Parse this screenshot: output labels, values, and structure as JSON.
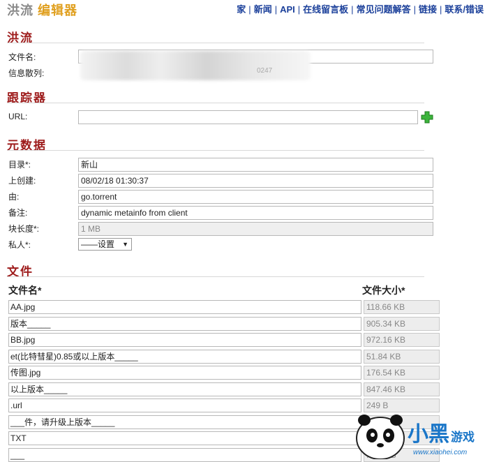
{
  "header": {
    "title_part1": "洪流",
    "title_part2": "编辑器",
    "nav": [
      "家",
      "新闻",
      "API",
      "在线留言板",
      "常见问题解答",
      "链接",
      "联系/错误"
    ]
  },
  "torrent": {
    "section_title": "洪流",
    "filename_label": "文件名:",
    "filename_value": "",
    "infohash_label": "信息散列:",
    "infohash_value": "0247"
  },
  "tracker": {
    "section_title": "跟踪器",
    "url_label": "URL:",
    "url_value": ""
  },
  "metadata": {
    "section_title": "元数据",
    "fields": [
      {
        "label": "目录*:",
        "value": "新山"
      },
      {
        "label": "上创建:",
        "value": "08/02/18 01:30:37"
      },
      {
        "label": "由:",
        "value": "go.torrent"
      },
      {
        "label": "备注:",
        "value": "dynamic metainfo from client"
      },
      {
        "label": "块长度*:",
        "value": "1 MB"
      }
    ],
    "private_label": "私人*:",
    "private_value": "——设置"
  },
  "files": {
    "section_title": "文件",
    "col_name": "文件名*",
    "col_size": "文件大小*",
    "rows": [
      {
        "name": "AA.jpg",
        "size": "118.66 KB"
      },
      {
        "name": "版本_____",
        "size": "905.34 KB"
      },
      {
        "name": "BB.jpg",
        "size": "972.16 KB"
      },
      {
        "name": "et(比特彗星)0.85或以上版本_____",
        "size": "51.84 KB"
      },
      {
        "name": "传图.jpg",
        "size": "176.54 KB"
      },
      {
        "name": "以上版本_____",
        "size": "847.46 KB"
      },
      {
        "name": ".url",
        "size": "249 B"
      },
      {
        "name": "___件，请升级上版本_____",
        "size": "...6 KB"
      },
      {
        "name": "TXT",
        "size": ""
      },
      {
        "name": "___",
        "size": "...50 KB"
      }
    ]
  },
  "watermark": {
    "brand": "小黑游戏",
    "url": "www.xiaohei.com"
  },
  "colors": {
    "section": "#9e1c1c",
    "nav": "#1a3f9a",
    "title_accent": "#e0a020"
  }
}
